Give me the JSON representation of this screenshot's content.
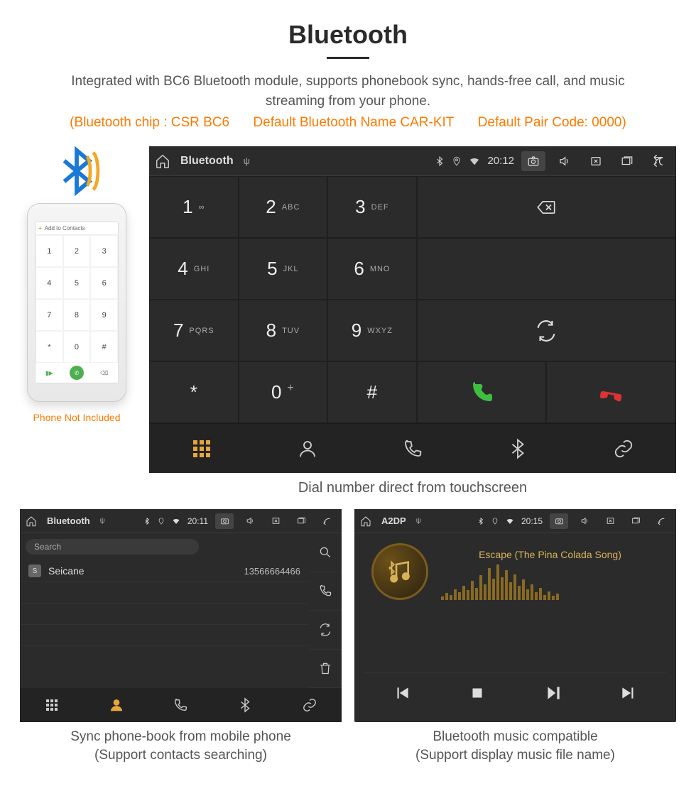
{
  "title": "Bluetooth",
  "description": "Integrated with BC6 Bluetooth module, supports phonebook sync, hands-free call, and music streaming from your phone.",
  "spec": {
    "chip": "(Bluetooth chip : CSR BC6",
    "name": "Default Bluetooth Name CAR-KIT",
    "code": "Default Pair Code: 0000)"
  },
  "phone_mock": {
    "add_contacts": "Add to Contacts",
    "caption": "Phone Not Included"
  },
  "dialer": {
    "statusbar": {
      "title": "Bluetooth",
      "time": "20:12"
    },
    "keys": [
      {
        "n": "1",
        "s": "∞"
      },
      {
        "n": "2",
        "s": "ABC"
      },
      {
        "n": "3",
        "s": "DEF"
      },
      {
        "n": "4",
        "s": "GHI"
      },
      {
        "n": "5",
        "s": "JKL"
      },
      {
        "n": "6",
        "s": "MNO"
      },
      {
        "n": "7",
        "s": "PQRS"
      },
      {
        "n": "8",
        "s": "TUV"
      },
      {
        "n": "9",
        "s": "WXYZ"
      },
      {
        "n": "*",
        "s": ""
      },
      {
        "n": "0",
        "s": "+"
      },
      {
        "n": "#",
        "s": ""
      }
    ],
    "caption": "Dial number direct from touchscreen"
  },
  "phonebook": {
    "statusbar": {
      "title": "Bluetooth",
      "time": "20:11"
    },
    "search_placeholder": "Search",
    "contacts": [
      {
        "badge": "S",
        "name": "Seicane",
        "number": "13566664466"
      }
    ],
    "caption_l1": "Sync phone-book from mobile phone",
    "caption_l2": "(Support contacts searching)"
  },
  "music": {
    "statusbar": {
      "title": "A2DP",
      "time": "20:15"
    },
    "track": "Escape (The Pina Colada Song)",
    "caption_l1": "Bluetooth music compatible",
    "caption_l2": "(Support display music file name)"
  }
}
